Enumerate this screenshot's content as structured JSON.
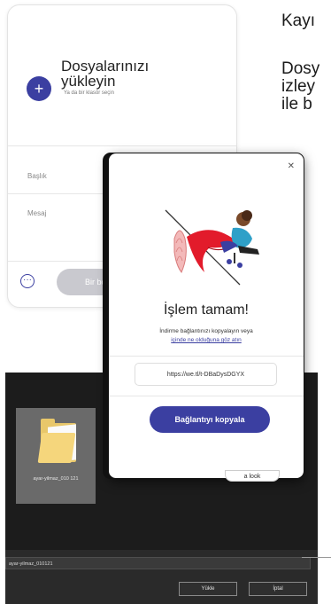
{
  "upload_card": {
    "title_line1": "Dosyalarınızı",
    "title_line2": "yükleyin",
    "subtitle": "Ya da bir klasör seçin",
    "field_title": "Başlık",
    "field_message": "Mesaj",
    "transfer_button": "Bir bo"
  },
  "background_text": {
    "line1": "Kayı",
    "line2": "Dosy",
    "line3": "izley",
    "line4": "ile b"
  },
  "modal": {
    "title": "İşlem tamam!",
    "text": "İndirme bağlantınızı kopyalayın veya",
    "link": "içinde ne olduğuna göz atın",
    "url": "https://we.tl/t-DBaDysDGYX",
    "copy_button": "Bağlantıyı kopyala",
    "tag": "a look"
  },
  "file_dialog": {
    "file_name": "ayar-yilmaz_010121",
    "file_name_tile": "ayar-yilmaz_010 121",
    "filename_field": "ayar-yilmaz_010121",
    "upload_button": "Yükle",
    "cancel_button": "İptal"
  }
}
